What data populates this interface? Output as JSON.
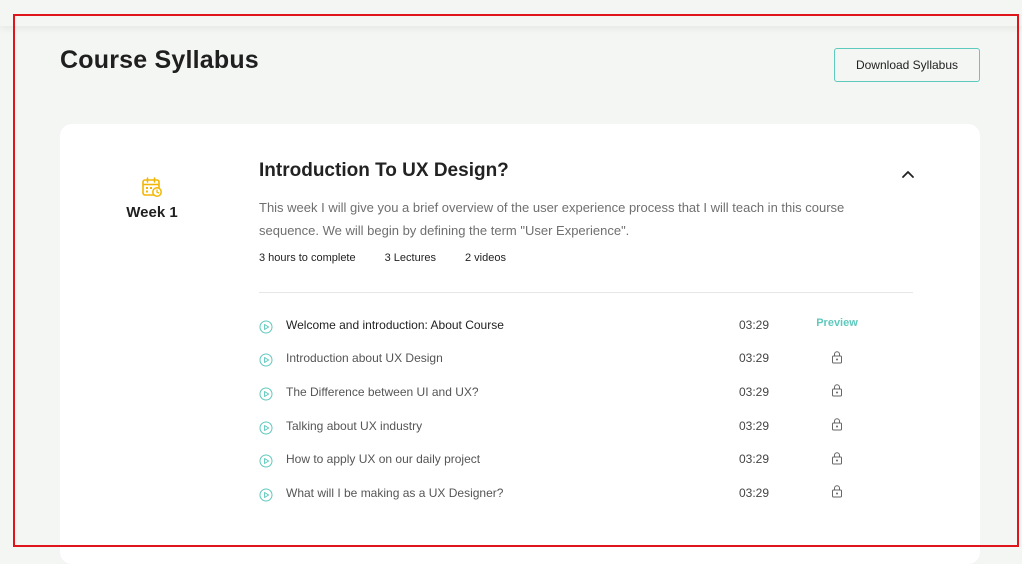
{
  "page": {
    "title": "Course Syllabus",
    "download_label": "Download Syllabus"
  },
  "colors": {
    "accent": "#5ec9bd",
    "calendar": "#f2b705",
    "highlight_border": "#e0141b",
    "background": "#f3f6f2"
  },
  "week": {
    "icon": "calendar-icon",
    "label": "Week 1"
  },
  "section": {
    "title": "Introduction To UX Design?",
    "collapse_icon": "chevron-up-icon",
    "description": "This week I will give you a brief overview of the user experience process that I will teach in this course sequence. We will begin by defining the term \"User Experience\".",
    "meta": {
      "hours": "3 hours to complete",
      "lectures": "3 Lectures",
      "videos": "2 videos"
    }
  },
  "lessons": [
    {
      "title": "Welcome and introduction: About Course",
      "duration": "03:29",
      "action": "Preview",
      "icon": "play-icon"
    },
    {
      "title": "Introduction about UX Design",
      "duration": "03:29",
      "action": "lock-icon",
      "icon": "play-icon"
    },
    {
      "title": "The Difference between UI and UX?",
      "duration": "03:29",
      "action": "lock-icon",
      "icon": "play-icon"
    },
    {
      "title": "Talking about UX industry",
      "duration": "03:29",
      "action": "lock-icon",
      "icon": "play-icon"
    },
    {
      "title": "How to apply UX on our daily project",
      "duration": "03:29",
      "action": "lock-icon",
      "icon": "play-icon"
    },
    {
      "title": "What will I be making as a UX Designer?",
      "duration": "03:29",
      "action": "lock-icon",
      "icon": "play-icon"
    }
  ]
}
